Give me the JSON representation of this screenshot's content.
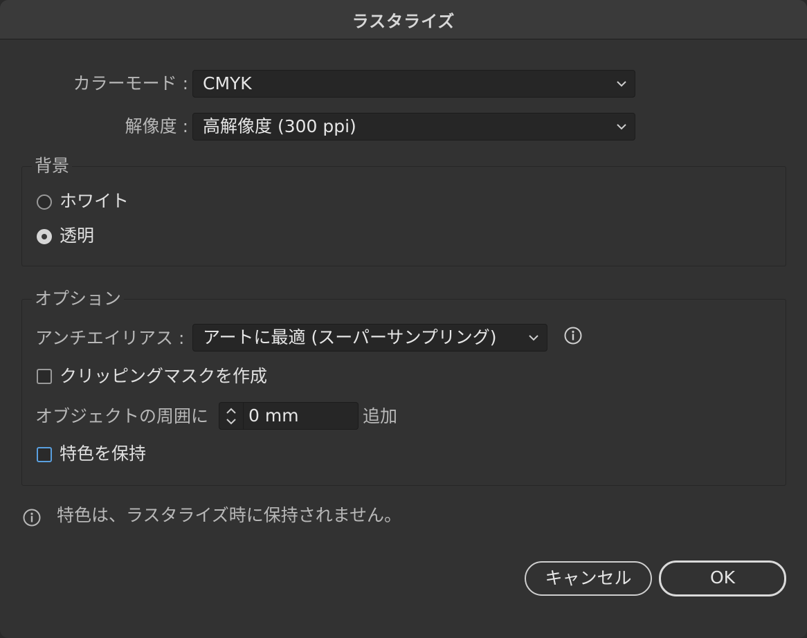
{
  "window": {
    "title": "ラスタライズ"
  },
  "color_mode": {
    "label": "カラーモード :",
    "value": "CMYK"
  },
  "resolution": {
    "label": "解像度 :",
    "value": "高解像度 (300 ppi)"
  },
  "background": {
    "title": "背景",
    "options": [
      {
        "label": "ホワイト",
        "checked": false
      },
      {
        "label": "透明",
        "checked": true
      }
    ]
  },
  "options": {
    "title": "オプション",
    "anti_alias": {
      "label": "アンチエイリアス :",
      "value": "アートに最適 (スーパーサンプリング)"
    },
    "clipping_mask": {
      "label": "クリッピングマスクを作成",
      "checked": false
    },
    "add_around": {
      "label": "オブジェクトの周囲に",
      "value": "0 mm",
      "suffix": "追加"
    },
    "keep_spot": {
      "label": "特色を保持",
      "checked": false
    }
  },
  "notice": {
    "text": "特色は、ラスタライズ時に保持されません。"
  },
  "buttons": {
    "cancel": "キャンセル",
    "ok": "OK"
  },
  "icons": {
    "chevron": "chevron-down-icon",
    "info": "info-icon",
    "stepper": "stepper-arrows-icon"
  },
  "colors": {
    "focus": "#5aa0e0"
  }
}
